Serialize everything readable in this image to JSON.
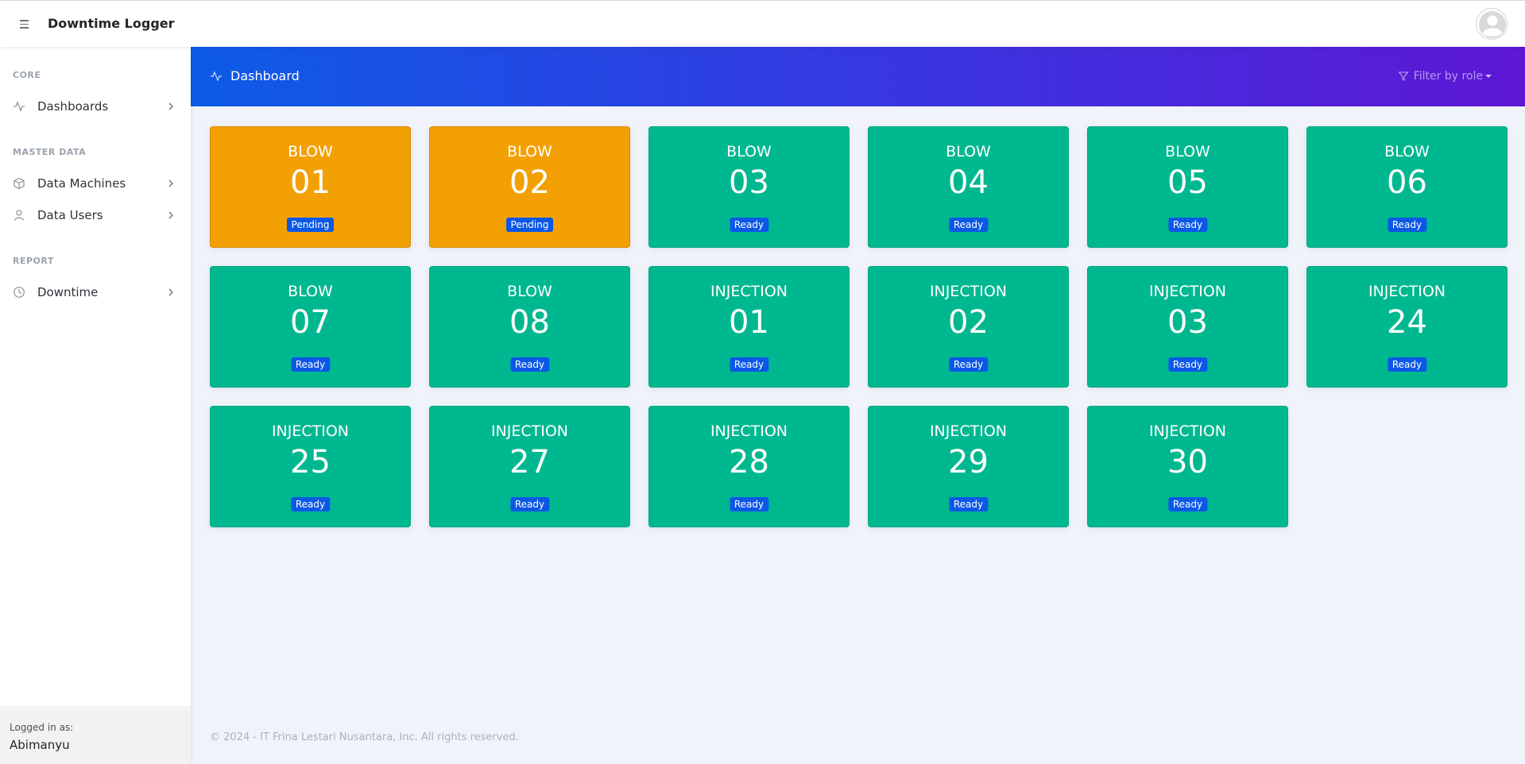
{
  "app": {
    "brand": "Downtime Logger"
  },
  "sidebar": {
    "sections": [
      {
        "heading": "CORE",
        "items": [
          {
            "label": "Dashboards",
            "icon": "activity-icon"
          }
        ]
      },
      {
        "heading": "MASTER DATA",
        "items": [
          {
            "label": "Data Machines",
            "icon": "box-icon"
          },
          {
            "label": "Data Users",
            "icon": "user-icon"
          }
        ]
      },
      {
        "heading": "REPORT",
        "items": [
          {
            "label": "Downtime",
            "icon": "clock-icon"
          }
        ]
      }
    ],
    "footer": {
      "logged_in_label": "Logged in as:",
      "user": "Abimanyu"
    }
  },
  "header": {
    "title": "Dashboard",
    "filter_label": "Filter by role"
  },
  "machines": [
    {
      "type": "BLOW",
      "number": "01",
      "status": "Pending"
    },
    {
      "type": "BLOW",
      "number": "02",
      "status": "Pending"
    },
    {
      "type": "BLOW",
      "number": "03",
      "status": "Ready"
    },
    {
      "type": "BLOW",
      "number": "04",
      "status": "Ready"
    },
    {
      "type": "BLOW",
      "number": "05",
      "status": "Ready"
    },
    {
      "type": "BLOW",
      "number": "06",
      "status": "Ready"
    },
    {
      "type": "BLOW",
      "number": "07",
      "status": "Ready"
    },
    {
      "type": "BLOW",
      "number": "08",
      "status": "Ready"
    },
    {
      "type": "INJECTION",
      "number": "01",
      "status": "Ready"
    },
    {
      "type": "INJECTION",
      "number": "02",
      "status": "Ready"
    },
    {
      "type": "INJECTION",
      "number": "03",
      "status": "Ready"
    },
    {
      "type": "INJECTION",
      "number": "24",
      "status": "Ready"
    },
    {
      "type": "INJECTION",
      "number": "25",
      "status": "Ready"
    },
    {
      "type": "INJECTION",
      "number": "27",
      "status": "Ready"
    },
    {
      "type": "INJECTION",
      "number": "28",
      "status": "Ready"
    },
    {
      "type": "INJECTION",
      "number": "29",
      "status": "Ready"
    },
    {
      "type": "INJECTION",
      "number": "30",
      "status": "Ready"
    }
  ],
  "colors": {
    "ready": "#00b890",
    "pending": "#f3a005",
    "badge": "#0b58e6"
  },
  "footer": {
    "copyright": "© 2024 - IT Frina Lestari Nusantara, Inc. All rights reserved."
  }
}
